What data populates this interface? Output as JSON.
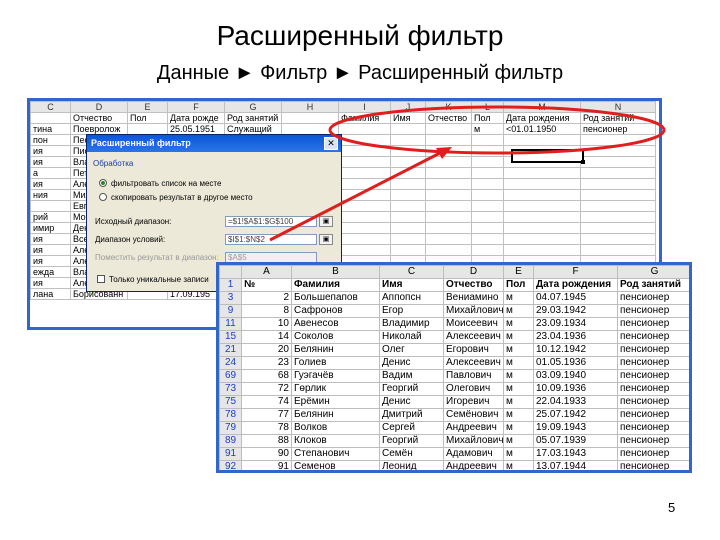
{
  "title": "Расширенный фильтр",
  "subtitle": "Данные ► Фильтр ► Расширенный фильтр",
  "page_number": "5",
  "colors": {
    "highlight": "#e01e1e",
    "frame": "#3366cc",
    "selected_column": "#f5c26b"
  },
  "background_sheet": {
    "columns": [
      "C",
      "D",
      "E",
      "F",
      "G",
      "H",
      "I",
      "J",
      "K",
      "L",
      "M",
      "N"
    ],
    "criteria_headers": [
      "Фамилия",
      "Имя",
      "Отчество",
      "Пол",
      "Дата рождения",
      "Род занятий"
    ],
    "criteria_values": [
      "",
      "",
      "",
      "м",
      "<01.01.1950",
      "пенсионер"
    ],
    "data_headers": [
      "Отчество",
      "Пол",
      "Дата рожде",
      "Род занятий"
    ],
    "first_row": [
      "Поевролож",
      "",
      "25.05.1951",
      "Служащий"
    ],
    "left_cells": [
      "тина",
      "пон",
      "ия",
      "ия",
      "а",
      "ия",
      "ния",
      "",
      "рий",
      "имир",
      "ия",
      "ия",
      "ия",
      "ежда",
      "ия",
      "лана"
    ],
    "d_cells": [
      "",
      "Пес",
      "Пис",
      "Вла",
      "Пет",
      "Але",
      "Мих",
      "Евг",
      "Мои",
      "Ден",
      "Все",
      "Але",
      "Але",
      "Вла",
      "Але",
      "Борисованн"
    ],
    "last_row_date": "17.09.195"
  },
  "dialog": {
    "title": "Расширенный фильтр",
    "group_label": "Обработка",
    "radio_in_place": "фильтровать список на месте",
    "radio_copy": "скопировать результат в другое место",
    "source_range_label": "Исходный диапазон:",
    "source_range_value": "=$1!$A$1:$G$100",
    "criteria_range_label": "Диапазон условий:",
    "criteria_range_value": "$I$1:$N$2",
    "copy_to_label": "Поместить результат в диапазон:",
    "copy_to_value": "$A$5",
    "unique_label": "Только уникальные записи"
  },
  "result_table": {
    "columns": [
      "",
      "A",
      "B",
      "C",
      "D",
      "E",
      "F",
      "G"
    ],
    "headers": [
      "1",
      "№",
      "Фамилия",
      "Имя",
      "Отчество",
      "Пол",
      "Дата рождения",
      "Род занятий"
    ],
    "rows": [
      [
        "3",
        "2",
        "Большепапов",
        "Аппопсн",
        "Вениамино",
        "м",
        "04.07.1945",
        "пенсионер"
      ],
      [
        "9",
        "8",
        "Сафронов",
        "Егор",
        "Михайлович",
        "м",
        "29.03.1942",
        "пенсионер"
      ],
      [
        "11",
        "10",
        "Авенесов",
        "Владимир",
        "Моисеевич",
        "м",
        "23.09.1934",
        "пенсионер"
      ],
      [
        "15",
        "14",
        "Соколов",
        "Николай",
        "Алексеевич",
        "м",
        "23.04.1936",
        "пенсионер"
      ],
      [
        "21",
        "20",
        "Белянин",
        "Олег",
        "Егорович",
        "м",
        "10.12.1942",
        "пенсионер"
      ],
      [
        "24",
        "23",
        "Голиев",
        "Денис",
        "Алексеевич",
        "м",
        "01.05.1936",
        "пенсионер"
      ],
      [
        "69",
        "68",
        "Гуэгачёв",
        "Вадим",
        "Павлович",
        "м",
        "03.09.1940",
        "пенсионер"
      ],
      [
        "73",
        "72",
        "Гөрлик",
        "Георгий",
        "Олегович",
        "м",
        "10.09.1936",
        "пенсионер"
      ],
      [
        "75",
        "74",
        "Ерёмин",
        "Денис",
        "Игоревич",
        "м",
        "22.04.1933",
        "пенсионер"
      ],
      [
        "78",
        "77",
        "Белянин",
        "Дмитрий",
        "Семёнович",
        "м",
        "25.07.1942",
        "пенсионер"
      ],
      [
        "79",
        "78",
        "Волков",
        "Сергей",
        "Андреевич",
        "м",
        "19.09.1943",
        "пенсионер"
      ],
      [
        "89",
        "88",
        "Клоков",
        "Георгий",
        "Михайлович",
        "м",
        "05.07.1939",
        "пенсионер"
      ],
      [
        "91",
        "90",
        "Степанович",
        "Семён",
        "Адамович",
        "м",
        "17.03.1943",
        "пенсионер"
      ],
      [
        "92",
        "91",
        "Семенов",
        "Леонид",
        "Андреевич",
        "м",
        "13.07.1944",
        "пенсионер"
      ]
    ]
  }
}
